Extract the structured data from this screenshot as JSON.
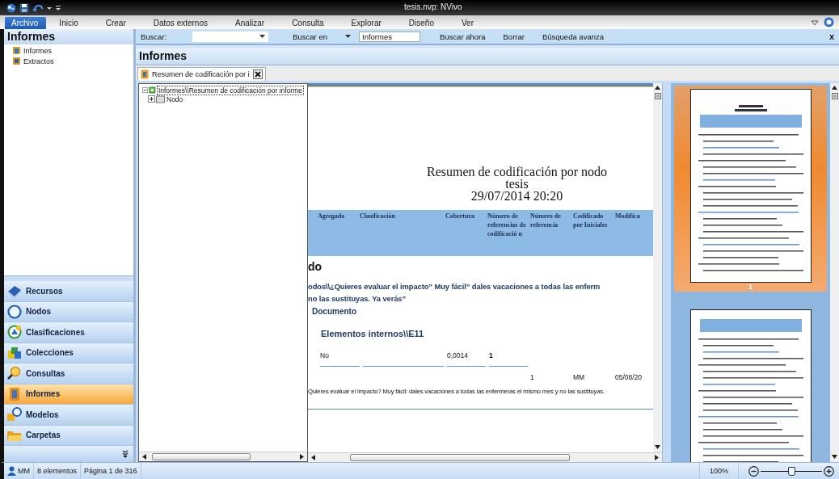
{
  "window": {
    "title": "tesis.nvp: NVivo"
  },
  "ribbon": {
    "tabs": [
      {
        "label": "Archivo",
        "selected": true
      },
      {
        "label": "Inicio",
        "selected": false
      },
      {
        "label": "Crear",
        "selected": false
      },
      {
        "label": "Datos externos",
        "selected": false
      },
      {
        "label": "Analizar",
        "selected": false
      },
      {
        "label": "Consulta",
        "selected": false
      },
      {
        "label": "Explorar",
        "selected": false
      },
      {
        "label": "Diseño",
        "selected": false
      },
      {
        "label": "Ver",
        "selected": false
      }
    ]
  },
  "nav": {
    "header": "Informes",
    "items": [
      {
        "label": "Informes",
        "selected": false
      },
      {
        "label": "Extractos",
        "selected": false
      }
    ],
    "buttons": [
      {
        "label": "Recursos",
        "selected": false
      },
      {
        "label": "Nodos",
        "selected": false
      },
      {
        "label": "Clasificaciones",
        "selected": false
      },
      {
        "label": "Colecciones",
        "selected": false
      },
      {
        "label": "Consultas",
        "selected": false
      },
      {
        "label": "Informes",
        "selected": true
      },
      {
        "label": "Modelos",
        "selected": false
      },
      {
        "label": "Carpetas",
        "selected": false
      }
    ]
  },
  "find_bar": {
    "label": "Buscar:",
    "look_in_label": "Buscar en",
    "look_in_value": "Informes",
    "buttons": [
      "Buscar ahora",
      "Borrar",
      "Búsqueda avanza"
    ],
    "close": "x"
  },
  "content": {
    "header": "Informes",
    "tab": {
      "label": "Resumen de codificación por i",
      "selected": true
    }
  },
  "tree": {
    "label": "Informes\\\\Resumen de codificación por informe",
    "expanded": true,
    "children": [
      {
        "label": "Nodo",
        "expanded": false
      }
    ]
  },
  "document": {
    "title": [
      "Resumen de codificación por nodo",
      "tesis",
      "29/07/2014 20:20"
    ],
    "columns": [
      "Agregado",
      "Clasificación",
      "Cobertura",
      "Número de referencias de codificació n",
      "Número de referencia",
      "Codificado por Iniciales",
      "Modifica"
    ],
    "section": "do",
    "node_lines": [
      "odos\\\\¿Quieres evaluar el impacto” Muy fácil” dales vacaciones a todas las enferm",
      "no las sustituyas. Ya verás”"
    ],
    "source_kind": "Documento",
    "source": "Elementos internos\\\\E11",
    "row": {
      "aggregate": "No",
      "coverage": "0,0014",
      "references": "1"
    },
    "ref_row": [
      "1",
      "MM",
      "05/08/20"
    ],
    "quote": "Quieres evaluar el impacto? Muy fácil: dales vacaciones a todas las enfermeras el mismo mes y no las sustituyas."
  },
  "thumbnails": [
    {
      "label": "1",
      "selected": true
    },
    {
      "selected": false
    }
  ],
  "status_bar": {
    "user": "MM",
    "count": "8 elementos",
    "page": "Página 1 de 316",
    "zoom": "100%",
    "zoom_slider": {
      "level": 0.5
    }
  }
}
